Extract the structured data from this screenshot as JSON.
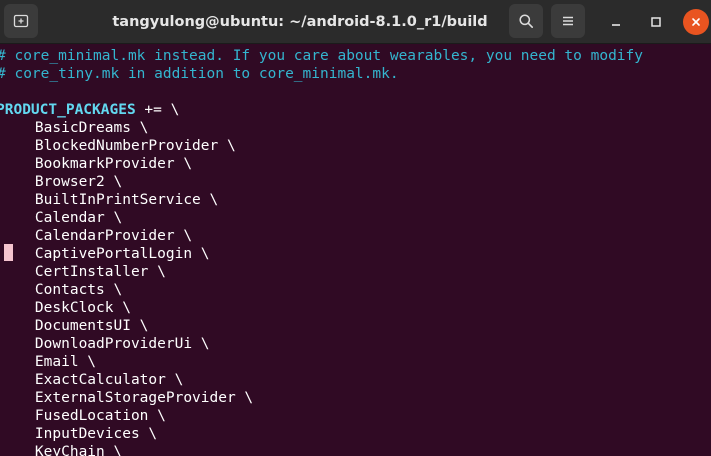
{
  "window": {
    "title": "tangyulong@ubuntu: ~/android-8.1.0_r1/build",
    "icons": {
      "new_tab": "new-tab-icon",
      "search": "search-icon",
      "menu": "hamburger-menu-icon",
      "minimize": "minimize-icon",
      "maximize": "maximize-icon",
      "close": "close-icon"
    },
    "colors": {
      "terminal_bg": "#300a24",
      "titlebar_bg": "#2b2b2b",
      "close_button": "#e95420",
      "comment": "#34b5cf",
      "variable": "#62d8f0",
      "text": "#ffffff",
      "cursor": "#f5c4cf"
    }
  },
  "terminal": {
    "comments": [
      "# core_minimal.mk instead. If you care about wearables, you need to modify",
      "# core_tiny.mk in addition to core_minimal.mk."
    ],
    "var_name": "PRODUCT_PACKAGES",
    "var_op": " += \\",
    "packages": [
      "    BasicDreams \\",
      "    BlockedNumberProvider \\",
      "    BookmarkProvider \\",
      "    Browser2 \\",
      "    BuiltInPrintService \\",
      "    Calendar \\",
      "    CalendarProvider \\",
      "    CaptivePortalLogin \\",
      "    CertInstaller \\",
      "    Contacts \\",
      "    DeskClock \\",
      "    DocumentsUI \\",
      "    DownloadProviderUi \\",
      "    Email \\",
      "    ExactCalculator \\",
      "    ExternalStorageProvider \\",
      "    FusedLocation \\",
      "    InputDevices \\",
      "    KeyChain \\"
    ]
  }
}
